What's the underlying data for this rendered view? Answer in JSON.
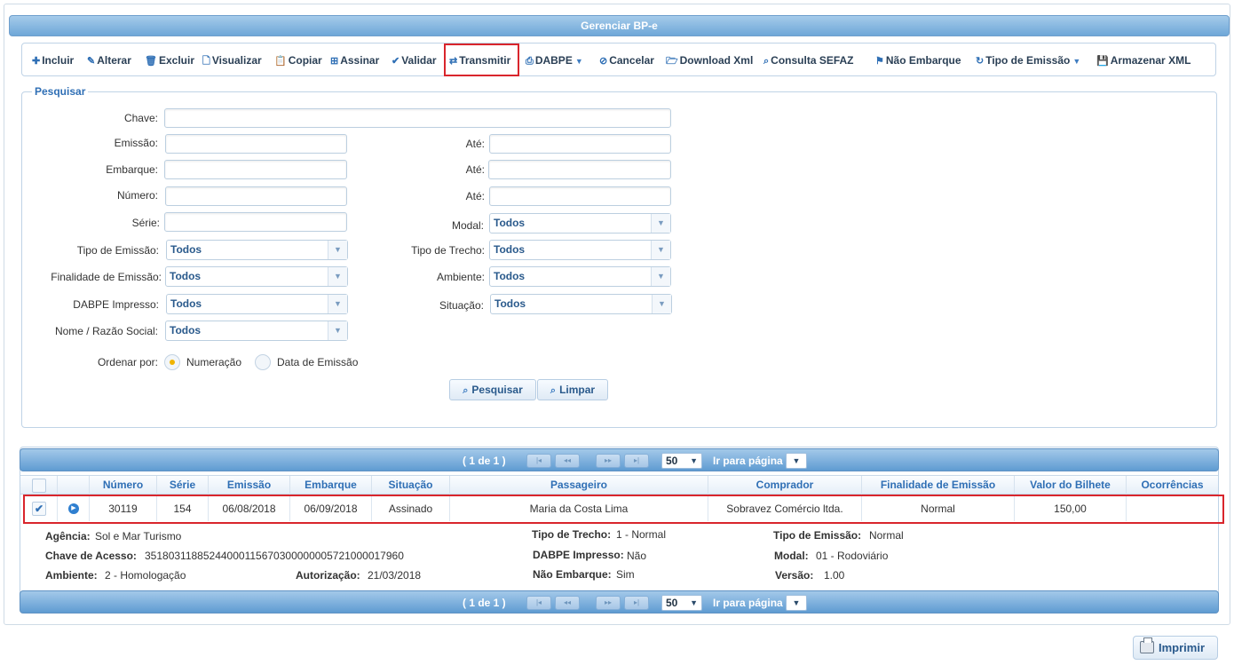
{
  "window": {
    "title": "Gerenciar BP-e"
  },
  "toolbar": {
    "incluir": "Incluir",
    "alterar": "Alterar",
    "excluir": "Excluir",
    "visualizar": "Visualizar",
    "copiar": "Copiar",
    "assinar": "Assinar",
    "validar": "Validar",
    "transmitir": "Transmitir",
    "dabpe": "DABPE",
    "cancelar": "Cancelar",
    "download_xml": "Download Xml",
    "consulta_sefaz": "Consulta SEFAZ",
    "nao_embarque": "Não Embarque",
    "tipo_emissao": "Tipo de Emissão",
    "armazenar_xml": "Armazenar XML"
  },
  "search": {
    "legend": "Pesquisar",
    "chave": "Chave:",
    "emissao": "Emissão:",
    "embarque": "Embarque:",
    "numero": "Número:",
    "serie": "Série:",
    "ate": "Até:",
    "modal": "Modal:",
    "tipo_emissao": "Tipo de Emissão:",
    "tipo_trecho": "Tipo de Trecho:",
    "finalidade": "Finalidade de Emissão:",
    "ambiente": "Ambiente:",
    "dabpe_impresso": "DABPE Impresso:",
    "situacao": "Situação:",
    "nome": "Nome / Razão Social:",
    "todos": "Todos",
    "ordenar": "Ordenar por:",
    "ord_numeracao": "Numeração",
    "ord_data": "Data de Emissão",
    "btn_pesquisar": "Pesquisar",
    "btn_limpar": "Limpar"
  },
  "pager": {
    "info": "( 1 de 1 )",
    "page_size": "50",
    "goto_label": "Ir para página"
  },
  "table": {
    "headers": [
      "Número",
      "Série",
      "Emissão",
      "Embarque",
      "Situação",
      "Passageiro",
      "Comprador",
      "Finalidade de Emissão",
      "Valor do Bilhete",
      "Ocorrências"
    ],
    "row": [
      "30119",
      "154",
      "06/08/2018",
      "06/09/2018",
      "Assinado",
      "Maria da Costa Lima",
      "Sobravez Comércio ltda.",
      "Normal",
      "150,00",
      ""
    ]
  },
  "details": {
    "agencia_k": "Agência:",
    "agencia_v": "Sol e Mar Turismo",
    "chave_k": "Chave de Acesso:",
    "chave_v": "35180311885244000115670300000005721000017960",
    "ambiente_k": "Ambiente:",
    "ambiente_v": "2 - Homologação",
    "autorizacao_k": "Autorização:",
    "autorizacao_v": "21/03/2018",
    "trecho_k": "Tipo de Trecho:",
    "trecho_v": "1 - Normal",
    "dabpe_k": "DABPE Impresso:",
    "dabpe_v": "Não",
    "naoemb_k": "Não Embarque:",
    "naoemb_v": "Sim",
    "tipoemi_k": "Tipo de Emissão:",
    "tipoemi_v": "Normal",
    "modal_k": "Modal:",
    "modal_v": "01 - Rodoviário",
    "versao_k": "Versão:",
    "versao_v": "1.00"
  },
  "footer": {
    "imprimir": "Imprimir"
  },
  "colors": {
    "accent": "#2f6fb5",
    "highlight": "#d9252c",
    "header_bar": "#6ea7d8"
  }
}
